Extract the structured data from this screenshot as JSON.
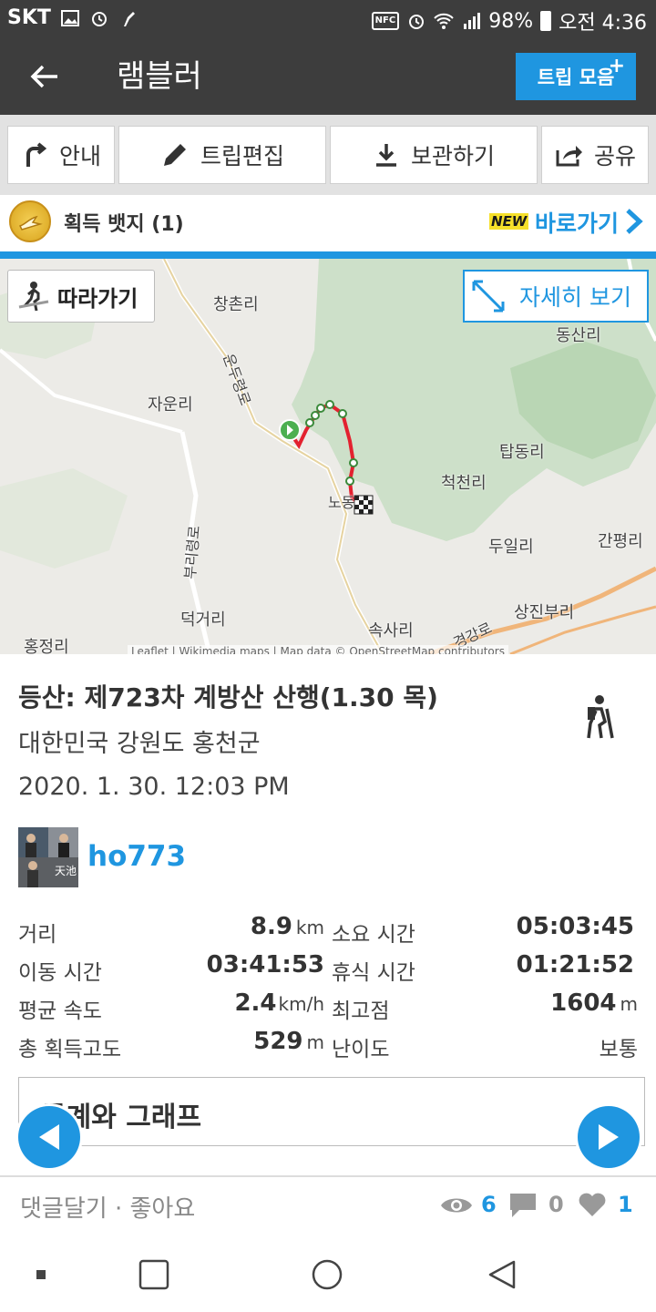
{
  "status_bar": {
    "carrier": "SKT",
    "battery": "98%",
    "time": "오전 4:36"
  },
  "app_bar": {
    "title": "램블러",
    "trip_button": "트립 모음",
    "trip_button_plus": "+"
  },
  "toolbar": {
    "guide": "안내",
    "edit": "트립편집",
    "save": "보관하기",
    "share": "공유"
  },
  "badge": {
    "text": "획득 뱃지 (1)",
    "new_tag": "NEW",
    "link": "바로가기"
  },
  "map": {
    "follow_button": "따라가기",
    "detail_button": "자세히 보기",
    "labels": [
      "창촌리",
      "동산리",
      "자운리",
      "탑동리",
      "척천리",
      "두일리",
      "간평리",
      "덕거리",
      "상진부리",
      "속사리",
      "홍정리",
      "노동리",
      "운두령로",
      "부리령로",
      "경강로"
    ],
    "attribution": "Leaflet | Wikimedia maps | Map data © OpenStreetMap contributors"
  },
  "trip": {
    "title": "등산: 제723차 계방산 산행(1.30 목)",
    "location": "대한민국 강원도 홍천군",
    "datetime": "2020. 1. 30. 12:03 PM",
    "username": "ho773",
    "avatar_caption": "天池"
  },
  "stats": {
    "distance_label": "거리",
    "distance_value": "8.9",
    "distance_unit": "km",
    "duration_label": "소요 시간",
    "duration_value": "05:03:45",
    "moving_label": "이동 시간",
    "moving_value": "03:41:53",
    "rest_label": "휴식 시간",
    "rest_value": "01:21:52",
    "speed_label": "평균 속도",
    "speed_value": "2.4",
    "speed_unit": "km/h",
    "peak_label": "최고점",
    "peak_value": "1604",
    "peak_unit": "m",
    "gain_label": "총 획득고도",
    "gain_value": "529",
    "gain_unit": "m",
    "difficulty_label": "난이도",
    "difficulty_value": "보통"
  },
  "graph": {
    "label": "통계와 그래프"
  },
  "comments": {
    "label": "댓글달기 · 좋아요",
    "views": "6",
    "comments": "0",
    "likes": "1"
  },
  "colors": {
    "accent": "#1f96e0",
    "route": "#e3212f",
    "appbar": "#3d3d3d"
  }
}
